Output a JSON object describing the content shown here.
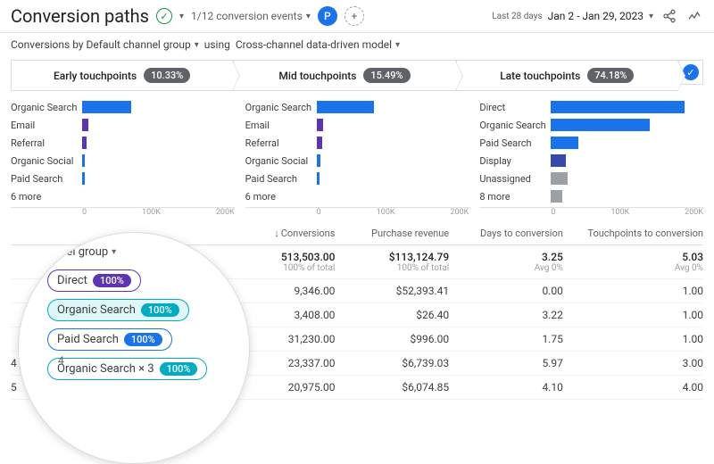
{
  "header": {
    "title": "Conversion paths",
    "events_selector": "1/12 conversion events",
    "avatar_letter": "P",
    "period_label": "Last 28 days",
    "date_range": "Jan 2 - Jan 29, 2023"
  },
  "subheader": {
    "dimension_label": "Conversions by Default channel group",
    "model_prefix": "using",
    "model_label": "Cross-channel data-driven model"
  },
  "tabs": [
    {
      "label": "Early touchpoints",
      "pct": "10.33%"
    },
    {
      "label": "Mid touchpoints",
      "pct": "15.49%"
    },
    {
      "label": "Late touchpoints",
      "pct": "74.18%"
    }
  ],
  "chart_data": [
    {
      "type": "bar",
      "orientation": "horizontal",
      "categories": [
        "Organic Search",
        "Email",
        "Referral",
        "Organic Social",
        "Paid Search",
        "6 more"
      ],
      "values": [
        65000,
        8000,
        6000,
        4000,
        3000,
        0
      ],
      "xlim": [
        0,
        200000
      ],
      "xticks": [
        "0",
        "100K",
        "200K"
      ],
      "colors": [
        "#1a73e8",
        "#5e35b1",
        "#5e35b1",
        "#1a73e8",
        "#1a73e8",
        ""
      ],
      "title": "Early touchpoints"
    },
    {
      "type": "bar",
      "orientation": "horizontal",
      "categories": [
        "Organic Search",
        "Email",
        "Referral",
        "Organic Social",
        "Paid Search",
        "6 more"
      ],
      "values": [
        75000,
        9000,
        7000,
        5000,
        3500,
        0
      ],
      "xlim": [
        0,
        200000
      ],
      "xticks": [
        "0",
        "100K",
        "200K"
      ],
      "colors": [
        "#1a73e8",
        "#5e35b1",
        "#5e35b1",
        "#1a73e8",
        "#1a73e8",
        ""
      ],
      "title": "Mid touchpoints"
    },
    {
      "type": "bar",
      "orientation": "horizontal",
      "categories": [
        "Direct",
        "Organic Search",
        "Paid Search",
        "Display",
        "Unassigned",
        "8 more"
      ],
      "values": [
        175000,
        130000,
        36000,
        20000,
        22000,
        15000
      ],
      "xlim": [
        0,
        200000
      ],
      "xticks": [
        "0",
        "100K",
        "200K"
      ],
      "colors": [
        "#1a73e8",
        "#1a73e8",
        "#1a73e8",
        "#3949ab",
        "#9aa0a6",
        "#9aa0a6"
      ],
      "title": "Late touchpoints"
    }
  ],
  "table": {
    "columns": {
      "channel": "annel group",
      "conversions": "Conversions",
      "revenue": "Purchase revenue",
      "days": "Days to conversion",
      "touchpoints": "Touchpoints to conversion"
    },
    "totals": {
      "conversions": "513,503.00",
      "conversions_sub": "100% of total",
      "revenue": "$113,124.79",
      "revenue_sub": "100% of total",
      "days": "3.25",
      "days_sub": "Avg 0%",
      "touchpoints": "5.03",
      "touchpoints_sub": "Avg 0%"
    },
    "rows": [
      {
        "idx": "",
        "conversions": "9,346.00",
        "revenue": "$52,393.41",
        "days": "0.00",
        "touchpoints": "1.00"
      },
      {
        "idx": "",
        "conversions": "3,408.00",
        "revenue": "$26.40",
        "days": "3.22",
        "touchpoints": "1.00"
      },
      {
        "idx": "",
        "conversions": "31,230.00",
        "revenue": "$996.00",
        "days": "1.75",
        "touchpoints": "1.00"
      },
      {
        "idx": "4",
        "conversions": "23,337.00",
        "revenue": "$6,739.03",
        "days": "5.97",
        "touchpoints": "3.00"
      },
      {
        "idx": "5",
        "conversions": "20,975.00",
        "revenue": "$6,074.85",
        "days": "4.10",
        "touchpoints": "4.00"
      }
    ]
  },
  "lens": {
    "header": "annel group",
    "items": [
      {
        "label": "Direct",
        "pill": "100%",
        "cls": "direct"
      },
      {
        "label": "Organic Search",
        "pill": "100%",
        "cls": "organic"
      },
      {
        "label": "Paid Search",
        "pill": "100%",
        "cls": "paid"
      },
      {
        "label": "Organic Search × 3",
        "pill": "100%",
        "cls": "o3",
        "pill_cls": "organic"
      }
    ]
  }
}
